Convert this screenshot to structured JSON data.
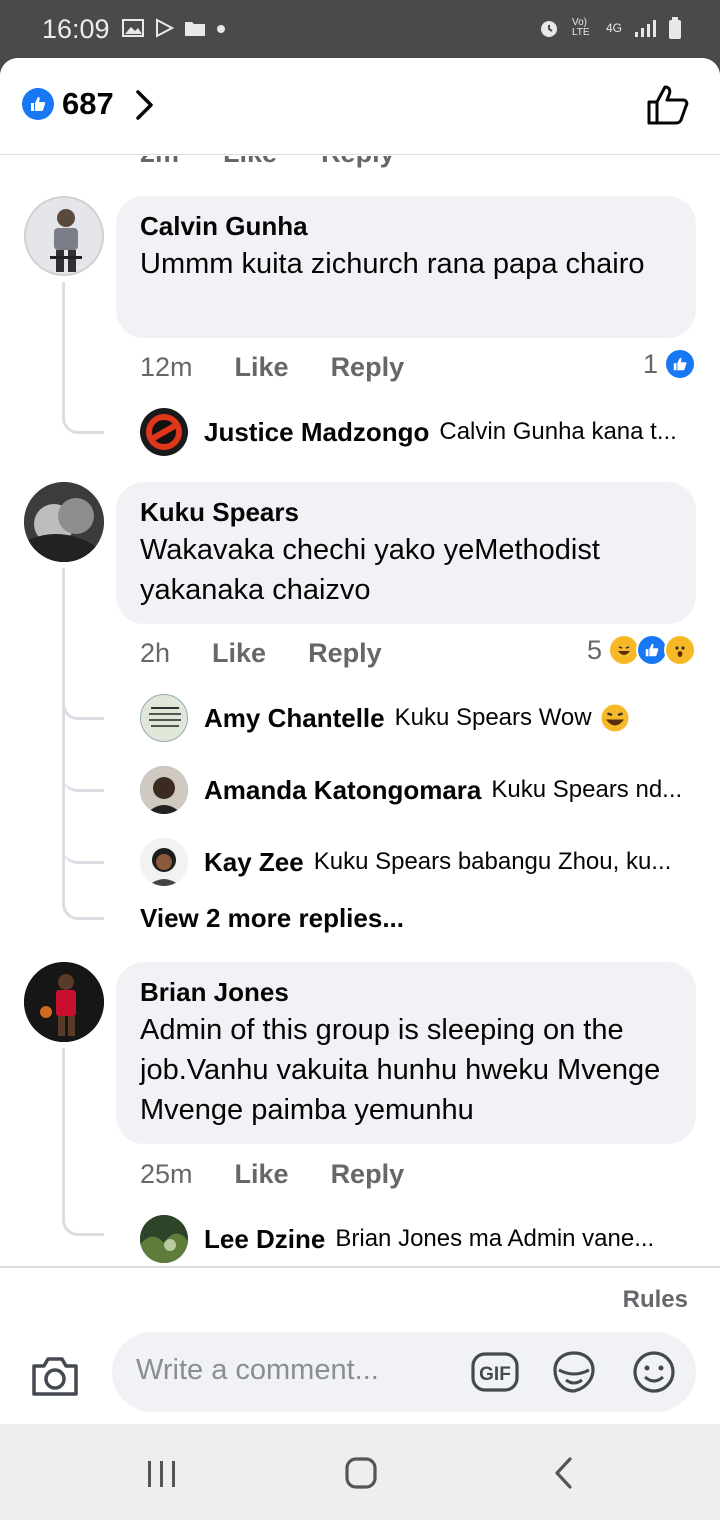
{
  "status_bar": {
    "time": "16:09",
    "network": "4G",
    "volte": "Vo) LTE"
  },
  "header": {
    "like_count": "687"
  },
  "cut_row": {
    "time": "2m",
    "like": "Like",
    "reply": "Reply"
  },
  "comments": [
    {
      "name": "Calvin Gunha",
      "text": "Ummm kuita zichurch rana papa chairo",
      "time": "12m",
      "like": "Like",
      "reply": "Reply",
      "reaction_count": "1",
      "replies": [
        {
          "name": "Justice Madzongo",
          "text": "Calvin Gunha kana t..."
        }
      ]
    },
    {
      "name": "Kuku Spears",
      "text": "Wakavaka chechi yako yeMethodist yakanaka chaizvo",
      "time": "2h",
      "like": "Like",
      "reply": "Reply",
      "reaction_count": "5",
      "replies": [
        {
          "name": "Amy Chantelle",
          "text": "Kuku Spears Wow"
        },
        {
          "name": "Amanda Katongomara",
          "text": "Kuku Spears nd..."
        },
        {
          "name": "Kay Zee",
          "text": "Kuku Spears babangu Zhou, ku..."
        }
      ],
      "view_more": "View 2 more replies..."
    },
    {
      "name": "Brian Jones",
      "text": "Admin of this group is sleeping on the job.Vanhu vakuita hunhu hweku Mvenge Mvenge paimba yemunhu",
      "time": "25m",
      "like": "Like",
      "reply": "Reply",
      "replies": [
        {
          "name": "Lee Dzine",
          "text": "Brian Jones  ma Admin vane..."
        }
      ]
    }
  ],
  "footer": {
    "rules": "Rules",
    "placeholder": "Write a comment...",
    "gif_label": "GIF"
  },
  "colors": {
    "accent": "#1877f2",
    "bubble": "#f0f2f5",
    "secondary_text": "#65676b"
  },
  "icons": [
    "like-icon",
    "chevron-right-icon",
    "thumbs-up-outline-icon",
    "camera-icon",
    "gif-icon",
    "sticker-icon",
    "emoji-icon",
    "haha-icon",
    "wow-icon"
  ]
}
